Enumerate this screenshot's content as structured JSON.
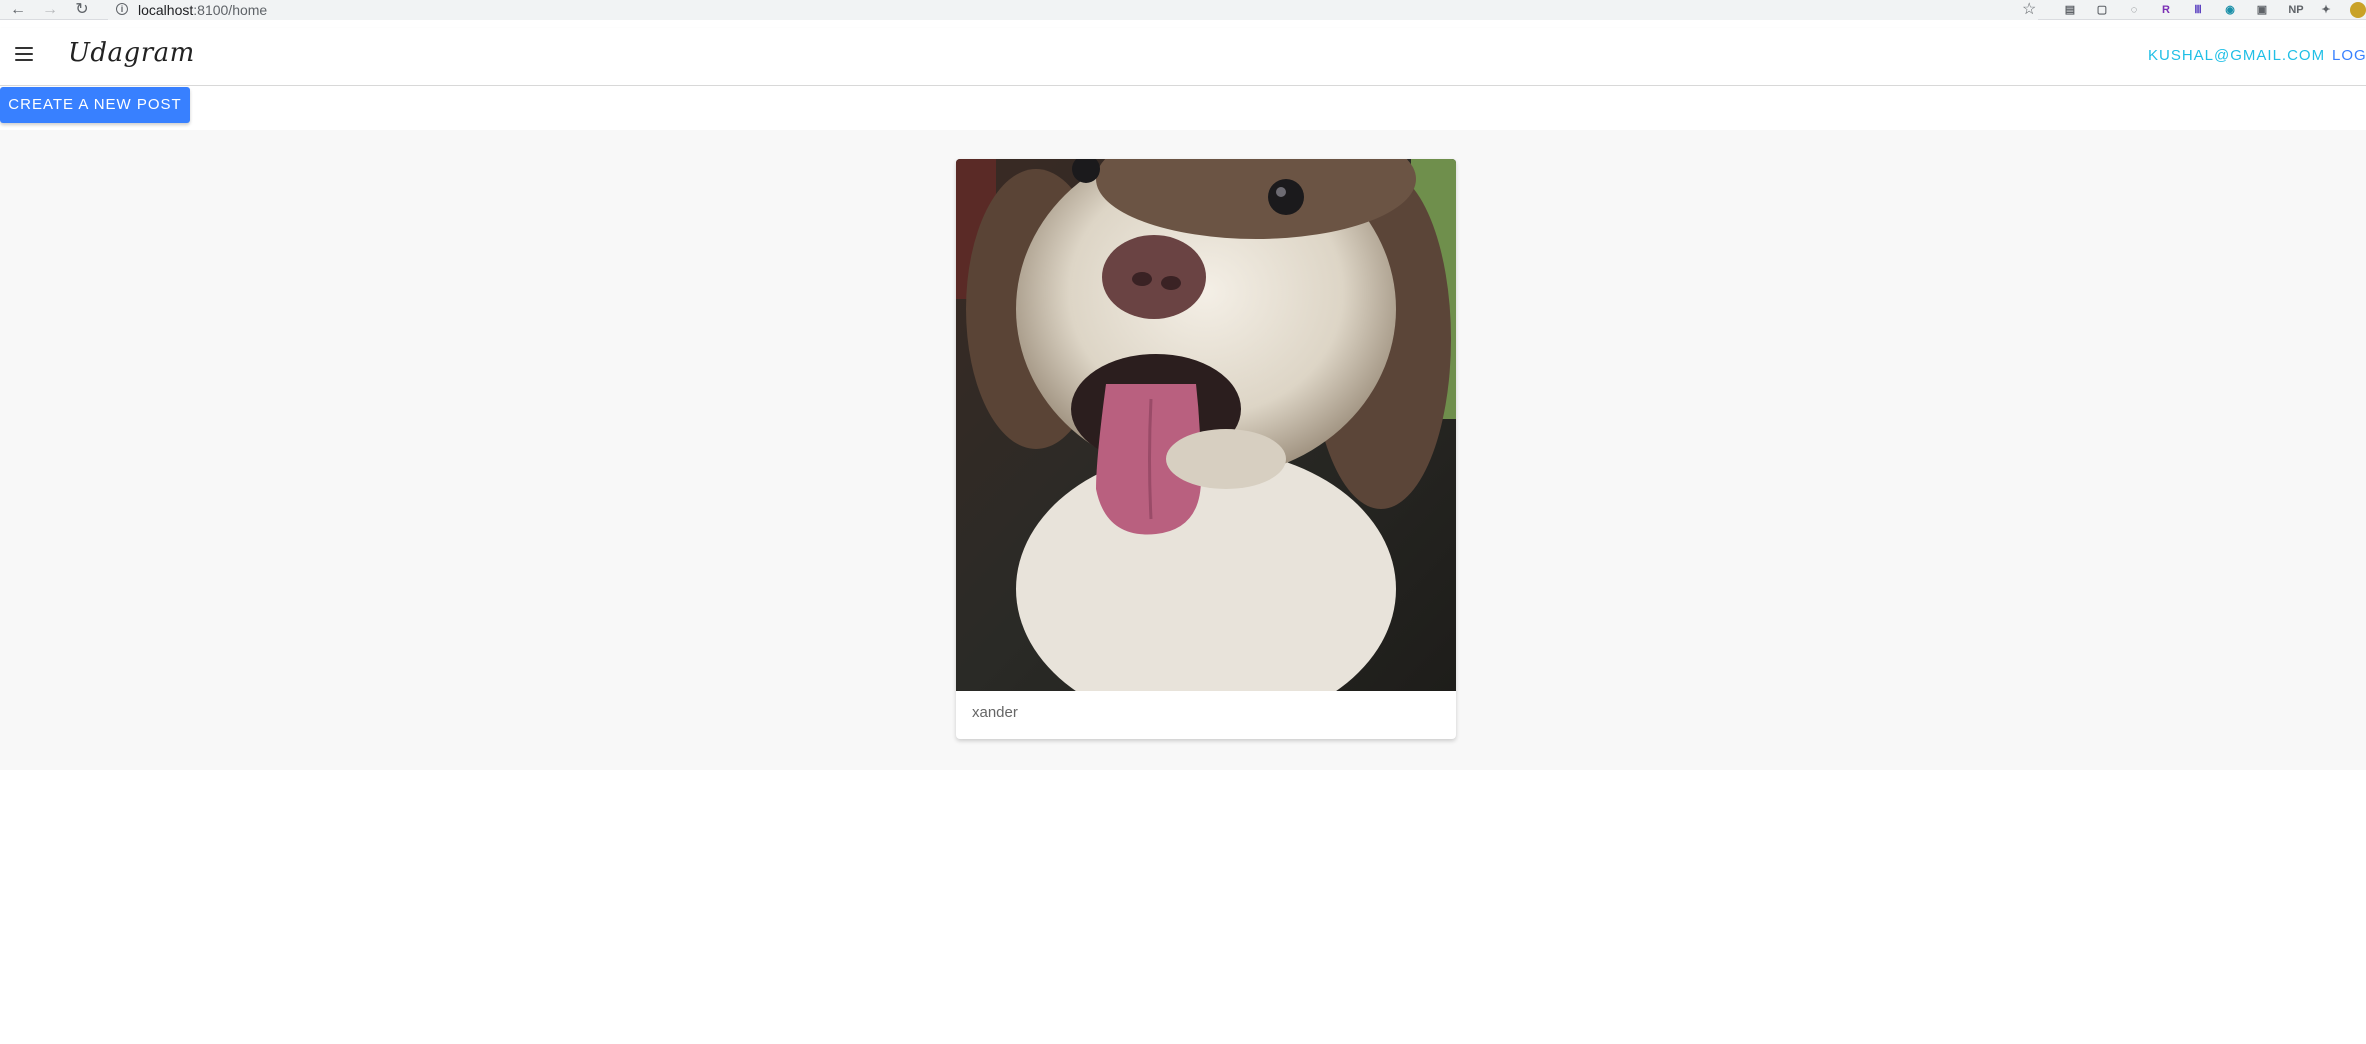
{
  "browser": {
    "back_icon": "←",
    "forward_icon": "→",
    "reload_icon": "↻",
    "url_host": "localhost",
    "url_path": ":8100/home",
    "star_icon": "☆",
    "extensions": [
      "▤",
      "▢",
      "◌",
      "R",
      "Ⅲ",
      "◉",
      "▣",
      "NP",
      "✦"
    ]
  },
  "header": {
    "brand": "Udagram",
    "user_email": "KUSHAL@GMAIL.COM",
    "logout_label": "LOG"
  },
  "toolbar": {
    "create_label": "CREATE A NEW POST"
  },
  "feed": {
    "items": [
      {
        "caption": "xander"
      }
    ]
  },
  "colors": {
    "primary": "#3880ff",
    "secondary": "#1fbfe6",
    "content_bg": "#f8f8f8"
  }
}
